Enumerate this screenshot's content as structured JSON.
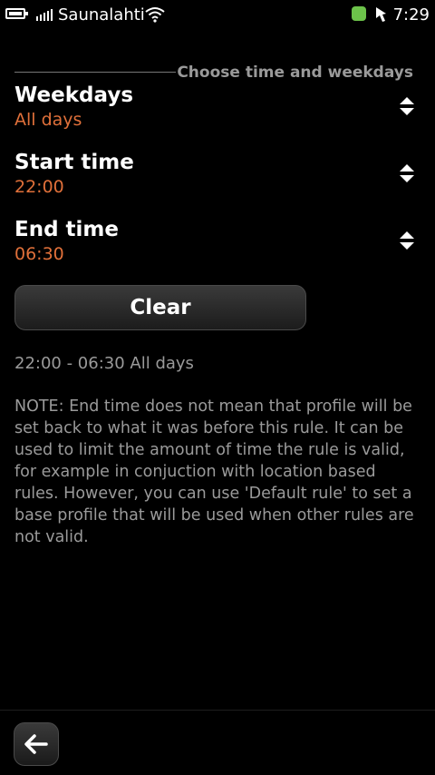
{
  "status_bar": {
    "operator": "Saunalahti",
    "time": "7:29",
    "icons": [
      "battery-icon",
      "signal-icon",
      "wifi-icon",
      "green-status-icon",
      "profile-icon"
    ]
  },
  "header": {
    "title": "Choose time and weekdays"
  },
  "settings": [
    {
      "label": "Weekdays",
      "value": "All days"
    },
    {
      "label": "Start time",
      "value": "22:00"
    },
    {
      "label": "End time",
      "value": "06:30"
    }
  ],
  "clear_button": {
    "label": "Clear"
  },
  "summary": "22:00 - 06:30 All days",
  "note": "NOTE: End time does not mean that profile will be set back to what it was before this rule. It can be used to limit the amount of time the rule is valid, for example in conjuction with location based rules. However, you can use 'Default rule' to set a base profile that will be used when other rules are not valid.",
  "toolbar": {
    "back_icon": "back-arrow-icon"
  },
  "colors": {
    "accent": "#e0703a",
    "secondary_text": "#9a9a9a",
    "background": "#000000"
  }
}
